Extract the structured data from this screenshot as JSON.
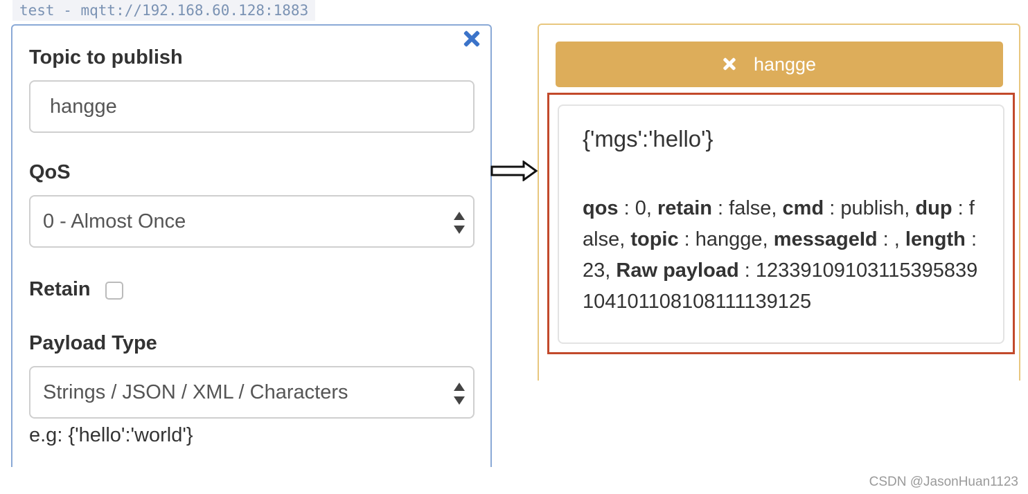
{
  "connection": {
    "label": "test - mqtt://192.168.60.128:1883"
  },
  "publish": {
    "topic_label": "Topic to publish",
    "topic_value": "hangge",
    "qos_label": "QoS",
    "qos_selected": "0 - Almost Once",
    "retain_label": "Retain",
    "retain_checked": false,
    "payload_type_label": "Payload Type",
    "payload_type_selected": "Strings / JSON / XML / Characters",
    "payload_hint": "e.g: {'hello':'world'}"
  },
  "subscription": {
    "topic": "hangge",
    "message": {
      "payload": "{'mgs':'hello'}",
      "fields": [
        {
          "key": "qos",
          "value": "0"
        },
        {
          "key": "retain",
          "value": "false"
        },
        {
          "key": "cmd",
          "value": "publish"
        },
        {
          "key": "dup",
          "value": "false"
        },
        {
          "key": "topic",
          "value": "hangge"
        },
        {
          "key": "messageId",
          "value": ""
        },
        {
          "key": "length",
          "value": "23"
        },
        {
          "key": "Raw payload",
          "value": "12339109103115395839104101108108111139125"
        }
      ]
    }
  },
  "colors": {
    "publish_border": "#8aa9d6",
    "close_icon": "#3b73c9",
    "subscription_border": "#e8c77e",
    "topic_button_bg": "#ddad5a",
    "highlight_frame": "#c2492b"
  },
  "icons": {
    "close": "close-icon",
    "qos_select": "select-arrows-icon",
    "payload_type_select": "select-arrows-icon",
    "topic_unsubscribe": "x-icon",
    "flow": "arrow-right-icon"
  },
  "watermark": "CSDN @JasonHuan1123"
}
